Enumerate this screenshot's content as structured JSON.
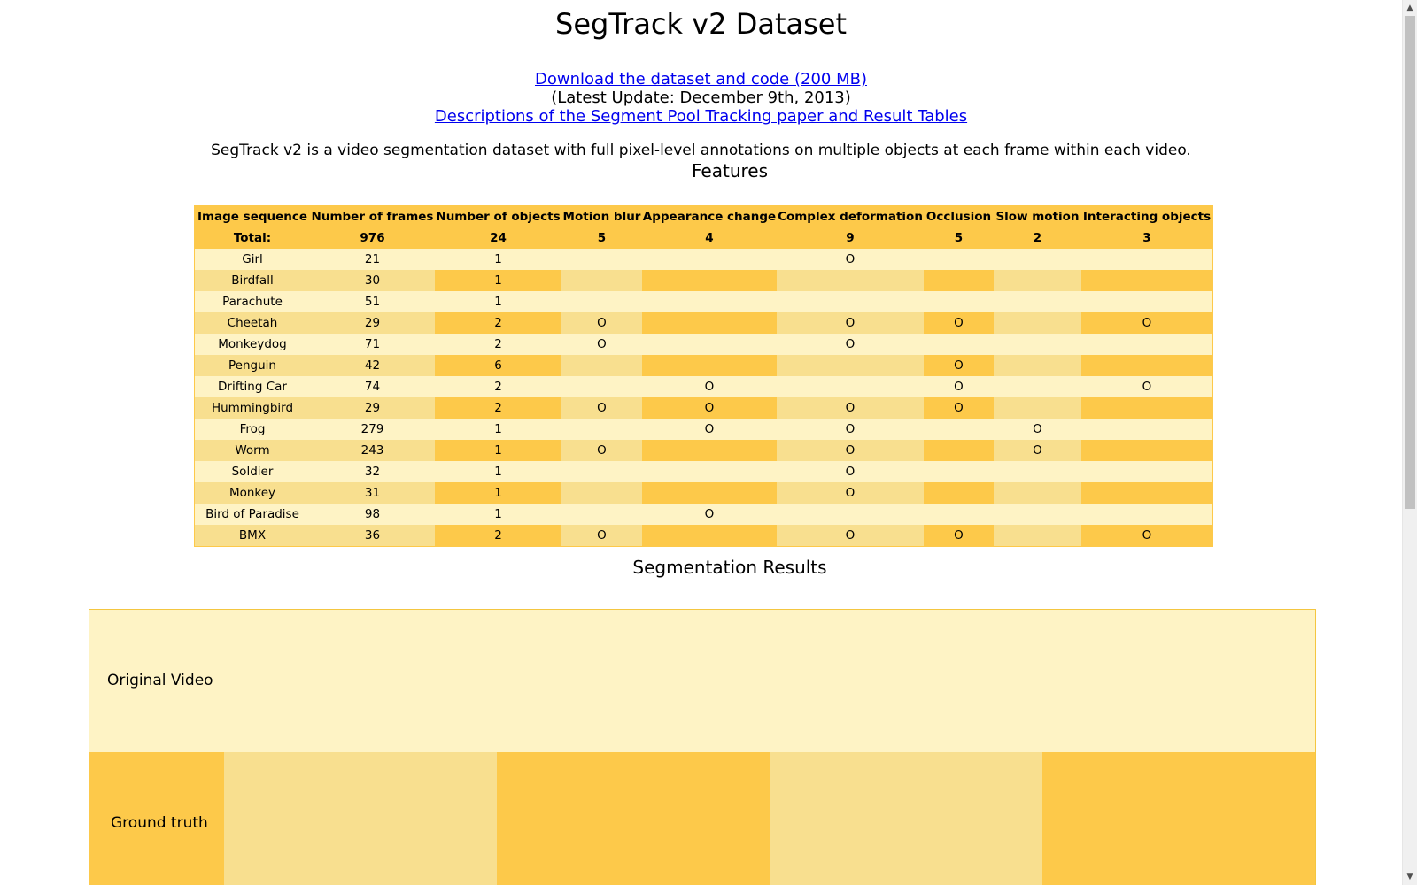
{
  "page": {
    "title": "SegTrack v2 Dataset",
    "download_link": "Download the dataset and code (200 MB)",
    "latest_update": "(Latest Update: December 9th, 2013)",
    "descriptions_link": "Descriptions of the Segment Pool Tracking paper and Result Tables",
    "description": "SegTrack v2 is a video segmentation dataset with full pixel-level annotations on multiple objects at each frame within each video.",
    "features_heading": "Features",
    "results_heading": "Segmentation Results"
  },
  "features_table": {
    "headers": [
      "Image sequence",
      "Number of frames",
      "Number of objects",
      "Motion blur",
      "Appearance change",
      "Complex deformation",
      "Occlusion",
      "Slow motion",
      "Interacting objects"
    ],
    "total": [
      "Total:",
      "976",
      "24",
      "5",
      "4",
      "9",
      "5",
      "2",
      "3"
    ],
    "rows": [
      [
        "Girl",
        "21",
        "1",
        "",
        "",
        "O",
        "",
        "",
        ""
      ],
      [
        "Birdfall",
        "30",
        "1",
        "",
        "",
        "",
        "",
        "",
        ""
      ],
      [
        "Parachute",
        "51",
        "1",
        "",
        "",
        "",
        "",
        "",
        ""
      ],
      [
        "Cheetah",
        "29",
        "2",
        "O",
        "",
        "O",
        "O",
        "",
        "O"
      ],
      [
        "Monkeydog",
        "71",
        "2",
        "O",
        "",
        "O",
        "",
        "",
        ""
      ],
      [
        "Penguin",
        "42",
        "6",
        "",
        "",
        "",
        "O",
        "",
        ""
      ],
      [
        "Drifting Car",
        "74",
        "2",
        "",
        "O",
        "",
        "O",
        "",
        "O"
      ],
      [
        "Hummingbird",
        "29",
        "2",
        "O",
        "O",
        "O",
        "O",
        "",
        ""
      ],
      [
        "Frog",
        "279",
        "1",
        "",
        "O",
        "O",
        "",
        "O",
        ""
      ],
      [
        "Worm",
        "243",
        "1",
        "O",
        "",
        "O",
        "",
        "O",
        ""
      ],
      [
        "Soldier",
        "32",
        "1",
        "",
        "",
        "O",
        "",
        "",
        ""
      ],
      [
        "Monkey",
        "31",
        "1",
        "",
        "",
        "O",
        "",
        "",
        ""
      ],
      [
        "Bird of Paradise",
        "98",
        "1",
        "",
        "O",
        "",
        "",
        "",
        ""
      ],
      [
        "BMX",
        "36",
        "2",
        "O",
        "",
        "O",
        "O",
        "",
        "O"
      ]
    ]
  },
  "results_table": {
    "row1_label": "Original Video",
    "row2_label": "Ground truth"
  },
  "colors": {
    "dark": "#fdc94a",
    "medium": "#f8df8f",
    "light": "#fef3c5",
    "link": "#0000ee"
  }
}
